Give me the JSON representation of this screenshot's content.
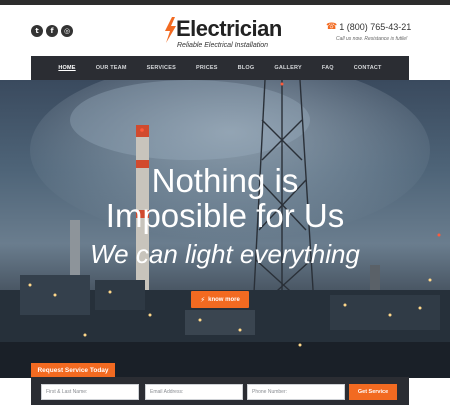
{
  "header": {
    "social": [
      {
        "icon": "twitter-icon",
        "glyph": "t"
      },
      {
        "icon": "facebook-icon",
        "glyph": "f"
      },
      {
        "icon": "instagram-icon",
        "glyph": "◎"
      }
    ],
    "logo": {
      "brand": "Electrician",
      "tagline": "Reliable Electrical Installation"
    },
    "phone": {
      "icon": "phone-icon",
      "number": "1 (800) 765-43-21",
      "note": "Call us now. Resistance is futile!"
    }
  },
  "nav": {
    "items": [
      "HOME",
      "OUR TEAM",
      "SERVICES",
      "PRICES",
      "BLOG",
      "GALLERY",
      "FAQ",
      "CONTACT"
    ],
    "active": "HOME"
  },
  "hero": {
    "headline_line1": "Nothing is",
    "headline_line2": "Imposible for Us",
    "subheadline": "We can light everything",
    "cta_label": "know more",
    "cta_icon": "lightning-icon"
  },
  "request": {
    "tab_label": "Request Service Today",
    "name_placeholder": "First & Last Name:",
    "email_placeholder": "Email Address:",
    "phone_placeholder": "Phone Number:",
    "submit_label": "Get Service"
  },
  "colors": {
    "accent": "#f26a21",
    "dark_bar": "#2b2d33"
  }
}
